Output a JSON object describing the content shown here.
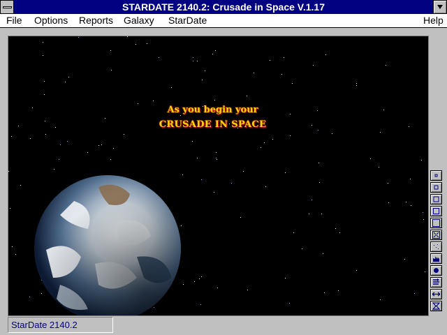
{
  "window": {
    "title": "STARDATE 2140.2: Crusade in Space V.1.17"
  },
  "menu": {
    "file": "File",
    "options": "Options",
    "reports": "Reports",
    "galaxy": "Galaxy",
    "stardate": "StarDate",
    "help": "Help"
  },
  "intro": {
    "line1": "As you begin your",
    "line2": "CRUSADE IN SPACE"
  },
  "toolbar": {
    "icons": [
      "tiny-square-icon",
      "small-square-icon",
      "medium-square-icon",
      "large-square-icon",
      "larger-square-icon",
      "zoom-fit-icon",
      "stars-icon",
      "fleet-icon",
      "planet-icon",
      "route-icon",
      "move-icon",
      "hourglass-icon"
    ]
  },
  "status": {
    "text": "StarDate 2140.2"
  },
  "colors": {
    "titlebar": "#000080",
    "intro_text": "#ffd700",
    "status_text": "#000080"
  }
}
